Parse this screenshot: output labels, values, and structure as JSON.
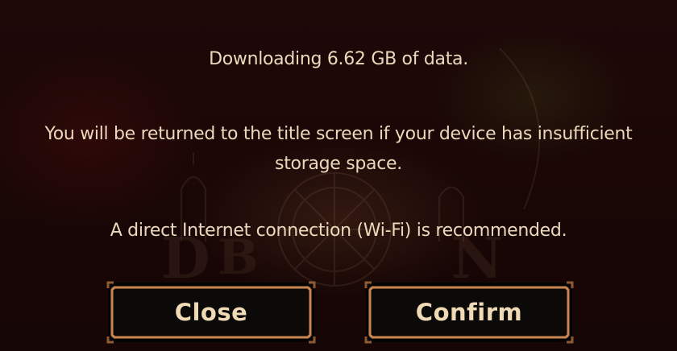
{
  "dialog": {
    "download_message": "Downloading 6.62 GB of data.",
    "storage_message_line1": "You will be returned to the title screen if your device has insufficient",
    "storage_message_line2": "storage space.",
    "wifi_message": "A direct Internet connection (Wi-Fi) is recommended."
  },
  "buttons": {
    "close_label": "Close",
    "confirm_label": "Confirm"
  },
  "colors": {
    "text": "#ecd9bb",
    "button_fill": "#0b0907",
    "button_border": "#d08a52",
    "background": "#1a0706"
  }
}
